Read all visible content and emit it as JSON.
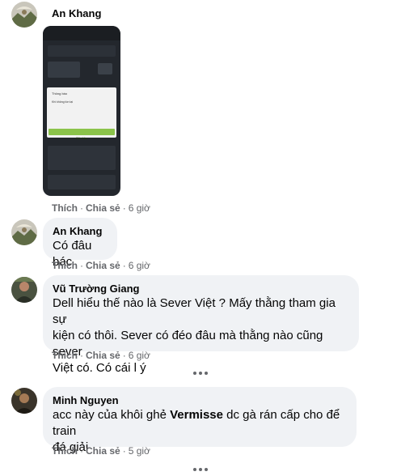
{
  "comments": [
    {
      "author": "An Khang",
      "actions": {
        "like": "Thích",
        "share": "Chia sẻ",
        "time": "6 giờ"
      },
      "attachment": {
        "dialog_title": "Thông báo",
        "dialog_body": "Khi không tồn tại",
        "dialog_button": "Đã nhận"
      }
    },
    {
      "author": "An Khang",
      "text": "Có đâu bác",
      "actions": {
        "like": "Thích",
        "share": "Chia sẻ",
        "time": "6 giờ"
      }
    },
    {
      "author": "Vũ Trường Giang",
      "text_lines": [
        "Dell hiểu thế nào là Sever Việt ? Mấy thằng tham gia sự",
        "kiện có thôi. Sever có đéo đâu mà thằng nào cũng sever",
        "Việt có. Có cái l ý"
      ],
      "actions": {
        "like": "Thích",
        "share": "Chia sẻ",
        "time": "6 giờ"
      }
    },
    {
      "author": "Minh Nguyen",
      "text_pre": "acc này của khôi ghẻ ",
      "text_bold": "Vermisse",
      "text_post": " dc gà rán cấp cho để train",
      "text_line2": "đá giải",
      "actions": {
        "like": "Thích",
        "share": "Chia sẻ",
        "time": "5 giờ"
      }
    }
  ],
  "colors": {
    "bubble": "#f0f2f5",
    "meta": "#65676b",
    "text": "#050505",
    "dialog_button": "#8bc34a"
  },
  "icons": [
    "more-replies-icon",
    "avatar"
  ]
}
